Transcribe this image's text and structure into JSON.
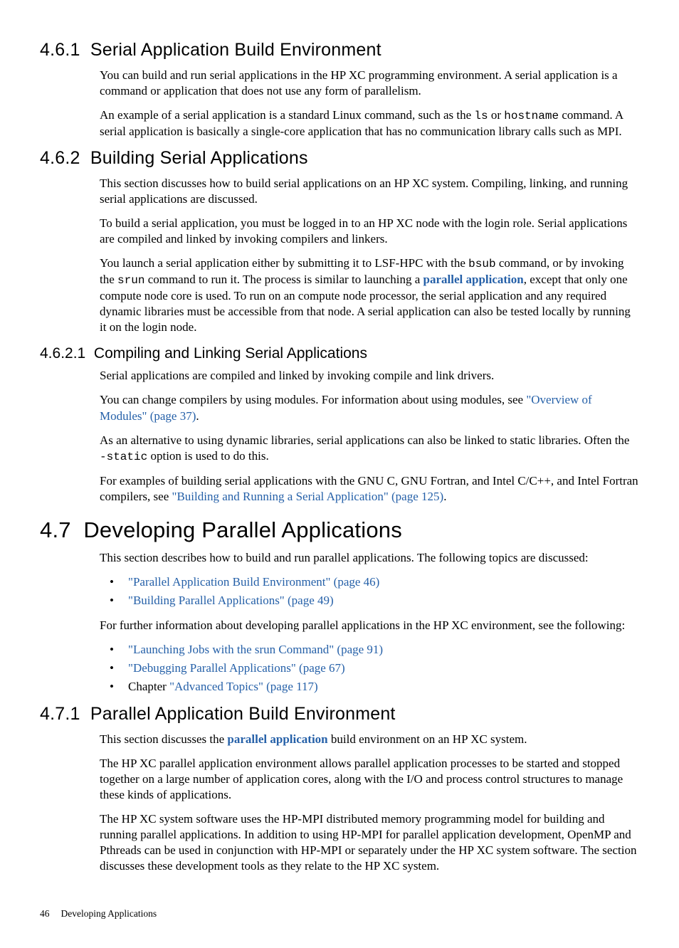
{
  "sections": {
    "s461": {
      "num": "4.6.1",
      "title": "Serial Application Build Environment",
      "p1": "You can build and run serial applications in the HP XC programming environment. A serial application is a command or application that does not use any form of parallelism.",
      "p2a": "An example of a serial application is a standard Linux command, such as the ",
      "p2_ls": "ls",
      "p2b": " or ",
      "p2_hostname": "hostname",
      "p2c": " command. A serial application is basically a single-core application that has no communication library calls such as MPI."
    },
    "s462": {
      "num": "4.6.2",
      "title": "Building Serial Applications",
      "p1": "This section discusses how to build serial applications on an HP XC system. Compiling, linking, and running serial applications are discussed.",
      "p2": "To build a serial application, you must be logged in to an HP XC node with the login role. Serial applications are compiled and linked by invoking compilers and linkers.",
      "p3a": "You launch a serial application either by submitting it to LSF-HPC with the ",
      "p3_bsub": "bsub",
      "p3b": " command, or by invoking the ",
      "p3_srun": "srun",
      "p3c": " command to run it. The process is similar to launching a ",
      "p3_parallel": "parallel application",
      "p3d": ", except that only one compute node core is used. To run on an compute node processor, the serial application and any required dynamic libraries must be accessible from that node. A serial application can also be tested locally by running it on the login node."
    },
    "s4621": {
      "num": "4.6.2.1",
      "title": "Compiling and Linking Serial Applications",
      "p1": "Serial applications are compiled and linked by invoking compile and link drivers.",
      "p2a": "You can change compilers by using modules. For information about using modules, see ",
      "p2_link": "\"Overview of Modules\" (page 37)",
      "p2b": ".",
      "p3a": "As an alternative to using dynamic libraries, serial applications can also be linked to static libraries. Often the ",
      "p3_static": "-static",
      "p3b": " option is used to do this.",
      "p4a": "For examples of building serial applications with the GNU C, GNU Fortran, and Intel C/C++, and Intel Fortran compilers, see ",
      "p4_link": "\"Building and Running a Serial Application\" (page 125)",
      "p4b": "."
    },
    "s47": {
      "num": "4.7",
      "title": "Developing Parallel Applications",
      "p1": "This section describes how to build and run parallel applications. The following topics are discussed:",
      "bullets1": [
        "\"Parallel Application Build Environment\" (page 46)",
        "\"Building Parallel Applications\" (page 49)"
      ],
      "p2": "For further information about developing parallel applications in the HP XC environment, see the following:",
      "bullets2_item1": "\"Launching Jobs with the srun Command\" (page 91)",
      "bullets2_item2": "\"Debugging Parallel Applications\" (page 67)",
      "bullets2_item3_prefix": "Chapter ",
      "bullets2_item3_link": "\"Advanced Topics\" (page 117)"
    },
    "s471": {
      "num": "4.7.1",
      "title": "Parallel Application Build Environment",
      "p1a": "This section discusses the ",
      "p1_parallel": "parallel application",
      "p1b": " build environment on an HP XC system.",
      "p2": "The HP XC parallel application environment allows parallel application processes to be started and stopped together on a large number of application cores, along with the I/O and process control structures to manage these kinds of applications.",
      "p3": "The HP XC system software uses the HP-MPI distributed memory programming model for building and running parallel applications. In addition to using HP-MPI for parallel application development, OpenMP and Pthreads can be used in conjunction with HP-MPI or separately under the HP XC system software. The section discusses these development tools as they relate to the HP XC system."
    }
  },
  "footer": {
    "page": "46",
    "chapter": "Developing Applications"
  }
}
